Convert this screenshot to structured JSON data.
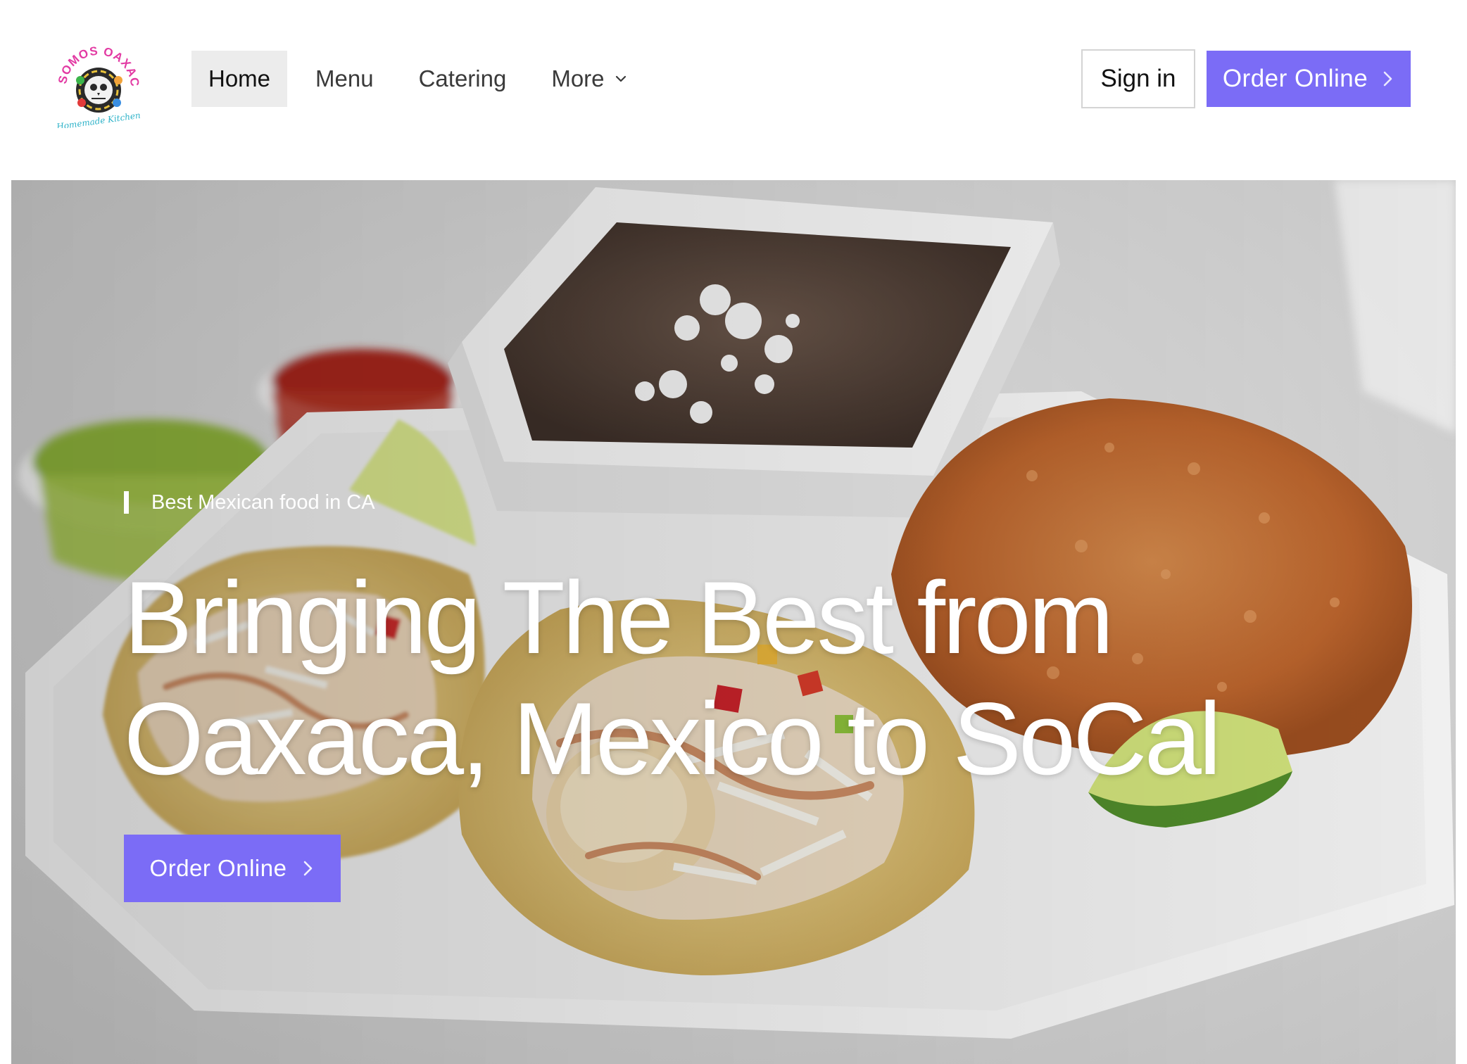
{
  "brand": {
    "logo_text": "SOMOS OAXACA",
    "logo_subtext": "Homemade Kitchen",
    "icon": "skull-logo-icon"
  },
  "nav": {
    "items": [
      {
        "label": "Home",
        "active": true
      },
      {
        "label": "Menu",
        "active": false
      },
      {
        "label": "Catering",
        "active": false
      },
      {
        "label": "More",
        "active": false,
        "icon": "chevron-down-icon"
      }
    ]
  },
  "header_actions": {
    "sign_in": "Sign in",
    "order_online": "Order Online",
    "order_icon": "chevron-right-icon"
  },
  "hero": {
    "tagline": "Best Mexican food in CA",
    "headline_line1": "Bringing The Best from",
    "headline_line2": "Oaxaca, Mexico to SoCal",
    "cta": "Order Online",
    "image_subject": "fish tacos with rice, beans and salsas"
  },
  "colors": {
    "accent": "#7b6cf6",
    "active_nav_bg": "#ececec",
    "text_dark": "#111111"
  }
}
